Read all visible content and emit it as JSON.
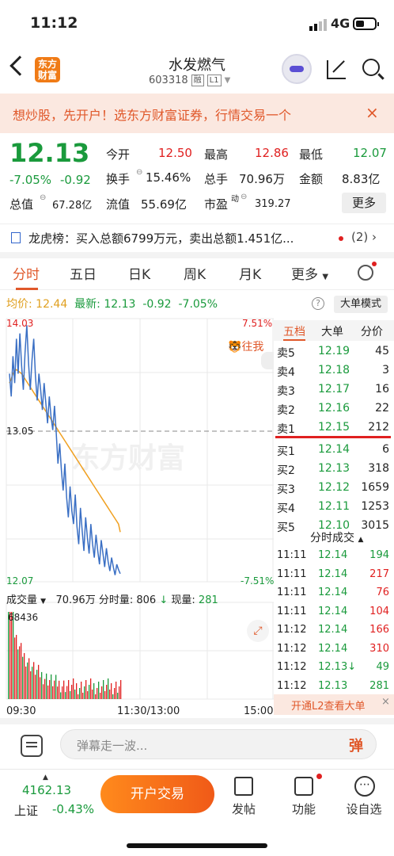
{
  "status": {
    "time": "11:12",
    "network": "4G"
  },
  "header": {
    "logo": "东方财富",
    "title": "水发燃气",
    "code": "603318",
    "tag1": "融",
    "tag2": "L1"
  },
  "banner": {
    "text": "想炒股，先开户！选东方财富证券，行情交易一个",
    "close": "×"
  },
  "quote": {
    "price": "12.13",
    "pct": "-7.05%",
    "chg": "-0.92",
    "open_l": "今开",
    "open_v": "12.50",
    "high_l": "最高",
    "high_v": "12.86",
    "low_l": "最低",
    "low_v": "12.07",
    "turn_l": "换手",
    "turn_v": "15.46%",
    "vol_l": "总手",
    "vol_v": "70.96万",
    "amt_l": "金额",
    "amt_v": "8.83亿",
    "mcap_l": "总值",
    "mcap_v": "67.28亿",
    "float_l": "流值",
    "float_v": "55.69亿",
    "pe_l": "市盈",
    "pe_sup": "动",
    "pe_v": "319.27",
    "more": "更多"
  },
  "lhb": {
    "text": "龙虎榜：买入总额6799万元，卖出总额1.451亿...",
    "count": "(2)"
  },
  "tabs": [
    "分时",
    "五日",
    "日K",
    "周K",
    "月K",
    "更多"
  ],
  "chartinfo": {
    "avg_l": "均价:",
    "avg_v": "12.44",
    "last_l": "最新:",
    "last_v": "12.13",
    "chg": "-0.92",
    "pct": "-7.05%",
    "help": "?",
    "mode": "大单模式"
  },
  "axis": {
    "top": "14.03",
    "top_pct": "7.51%",
    "mid": "13.05",
    "bot": "12.07",
    "bot_pct": "-7.51%",
    "t0": "09:30",
    "t1": "11:30/13:00",
    "t2": "15:00",
    "watermark": "东方财富",
    "wo": "往我"
  },
  "vol": {
    "label": "成交量",
    "total": "70.96万",
    "fen_l": "分时量:",
    "fen_v": "806",
    "cur_l": "现量:",
    "cur_v": "281",
    "max": "68436"
  },
  "orderbook": {
    "tab1": "五档",
    "tab2": "大单",
    "tab3": "分价",
    "sells": [
      {
        "l": "卖5",
        "p": "12.19",
        "v": "45"
      },
      {
        "l": "卖4",
        "p": "12.18",
        "v": "3"
      },
      {
        "l": "卖3",
        "p": "12.17",
        "v": "16"
      },
      {
        "l": "卖2",
        "p": "12.16",
        "v": "22"
      },
      {
        "l": "卖1",
        "p": "12.15",
        "v": "212"
      }
    ],
    "buys": [
      {
        "l": "买1",
        "p": "12.14",
        "v": "6"
      },
      {
        "l": "买2",
        "p": "12.13",
        "v": "318"
      },
      {
        "l": "买3",
        "p": "12.12",
        "v": "1659"
      },
      {
        "l": "买4",
        "p": "12.11",
        "v": "1253"
      },
      {
        "l": "买5",
        "p": "12.10",
        "v": "3015"
      }
    ]
  },
  "trades": {
    "title": "分时成交",
    "rows": [
      {
        "t": "11:11",
        "p": "12.14",
        "v": "194",
        "c": "g"
      },
      {
        "t": "11:11",
        "p": "12.14",
        "v": "217",
        "c": "r"
      },
      {
        "t": "11:11",
        "p": "12.14",
        "v": "76",
        "c": "r"
      },
      {
        "t": "11:11",
        "p": "12.14",
        "v": "104",
        "c": "r"
      },
      {
        "t": "11:12",
        "p": "12.14",
        "v": "166",
        "c": "r"
      },
      {
        "t": "11:12",
        "p": "12.14",
        "v": "310",
        "c": "r"
      },
      {
        "t": "11:12",
        "p": "12.13↓",
        "v": "49",
        "c": "g"
      },
      {
        "t": "11:12",
        "p": "12.13",
        "v": "281",
        "c": "g"
      }
    ]
  },
  "l2": {
    "text": "开通L2查看大单",
    "close": "×"
  },
  "danmu": {
    "placeholder": "弹幕走一波...",
    "btn": "弹"
  },
  "bottom": {
    "index_v": "4162.13",
    "index_name": "上证",
    "index_pct": "-0.43%",
    "open": "开户交易",
    "post": "发帖",
    "func": "功能",
    "custom": "设自选"
  },
  "chart_data": {
    "type": "line",
    "price_series": [
      13.62,
      13.45,
      13.75,
      13.55,
      13.88,
      13.62,
      13.92,
      13.68,
      13.5,
      13.78,
      13.98,
      13.7,
      13.5,
      13.72,
      13.88,
      13.6,
      13.42,
      13.62,
      13.5,
      13.35,
      13.55,
      13.4,
      13.25,
      13.45,
      13.3,
      13.2,
      13.38,
      13.18,
      12.95,
      13.1,
      12.9,
      12.75,
      12.95,
      12.7,
      12.55,
      12.78,
      12.6,
      12.5,
      12.72,
      12.48,
      12.35,
      12.62,
      12.45,
      12.3,
      12.55,
      12.4,
      12.28,
      12.5,
      12.35,
      12.25,
      12.42,
      12.3,
      12.2,
      12.38,
      12.28,
      12.18,
      12.32,
      12.22,
      12.15,
      12.25,
      12.18,
      12.12,
      12.2,
      12.16,
      12.13
    ],
    "avg_series": [
      13.55,
      13.58,
      13.62,
      13.64,
      13.65,
      13.64,
      13.63,
      13.62,
      13.6,
      13.58,
      13.56,
      13.54,
      13.52,
      13.5,
      13.48,
      13.46,
      13.44,
      13.42,
      13.4,
      13.38,
      13.36,
      13.34,
      13.32,
      13.3,
      13.28,
      13.26,
      13.24,
      13.22,
      13.2,
      13.18,
      13.16,
      13.14,
      13.12,
      13.1,
      13.08,
      13.06,
      13.04,
      13.02,
      13.0,
      12.98,
      12.96,
      12.94,
      12.92,
      12.9,
      12.88,
      12.86,
      12.84,
      12.82,
      12.8,
      12.78,
      12.76,
      12.74,
      12.72,
      12.7,
      12.68,
      12.66,
      12.64,
      12.62,
      12.6,
      12.58,
      12.56,
      12.54,
      12.52,
      12.5,
      12.44
    ],
    "ylim": [
      12.07,
      14.03
    ],
    "prev_close": 13.05
  },
  "colors": {
    "green": "#1a9a3c",
    "red": "#e02020",
    "orange": "#e0582a"
  }
}
